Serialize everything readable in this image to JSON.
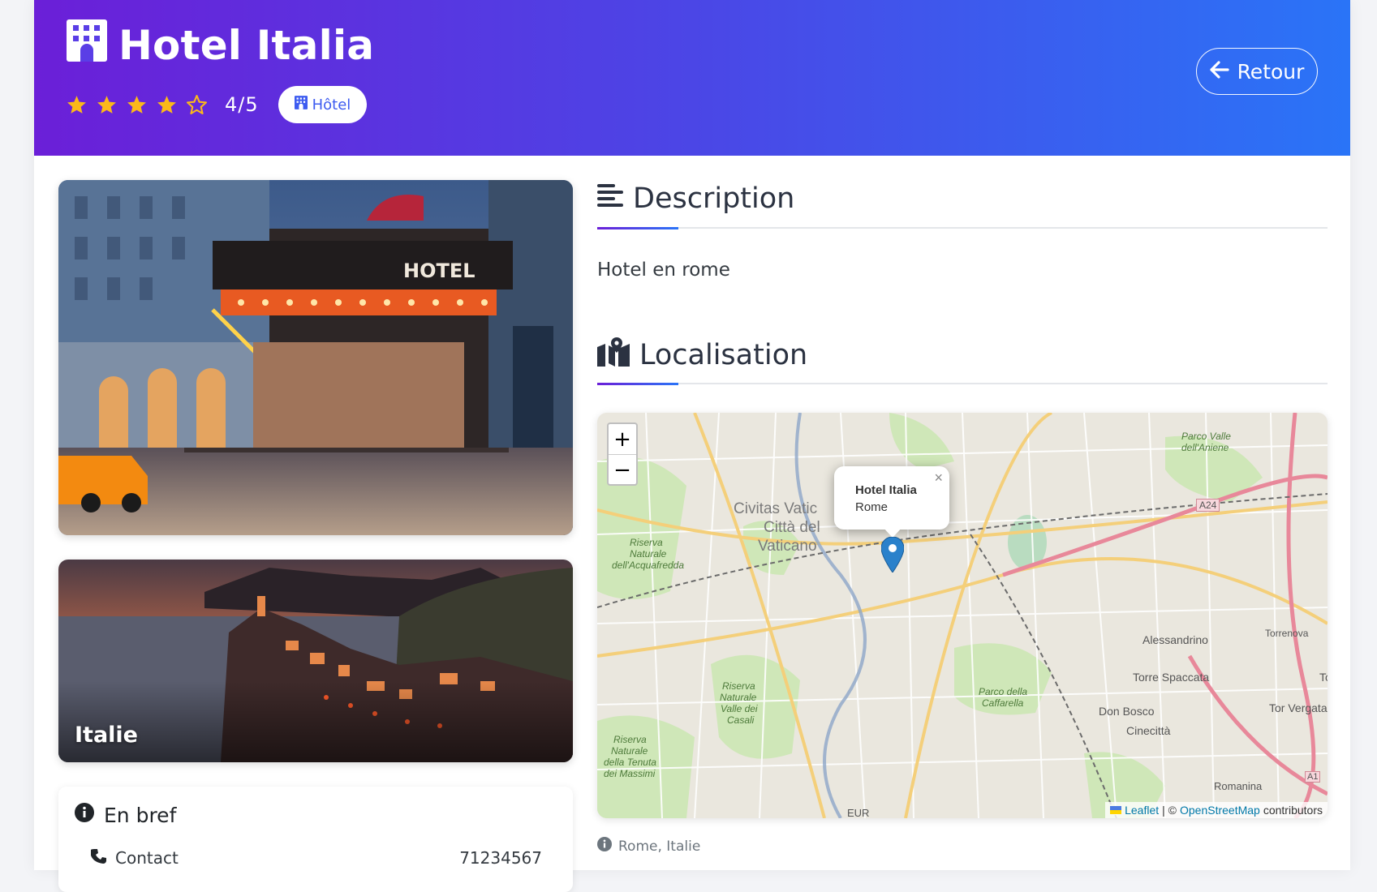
{
  "header": {
    "title": "Hotel Italia",
    "rating": 4,
    "rating_max": 5,
    "rating_text": "4/5",
    "type_badge": "Hôtel",
    "back_label": "Retour",
    "gradient_start": "#6b1fd8",
    "gradient_end": "#2a74f7"
  },
  "photo": {
    "sign_text": "HOTEL"
  },
  "destination": {
    "label": "Italie"
  },
  "brief": {
    "title": "En bref",
    "contact_label": "Contact",
    "contact_value": "71234567"
  },
  "description": {
    "heading": "Description",
    "text": "Hotel en rome"
  },
  "localisation": {
    "heading": "Localisation",
    "zoom_in": "+",
    "zoom_out": "−",
    "popup_title": "Hotel Italia",
    "popup_subtitle": "Rome",
    "popup_close": "×",
    "attribution_leaflet": "Leaflet",
    "attribution_sep": "| ©",
    "attribution_osm": "OpenStreetMap",
    "attribution_tail": "contributors",
    "address": "Rome, Italie",
    "labels": {
      "vatican_1": "Civitas Vatic",
      "vatican_2": "Città del",
      "vatican_3": "Vaticano",
      "riserva_1": "Riserva",
      "riserva_2": "Naturale",
      "riserva_3": "dell'Acquafredda",
      "parco_aniene_1": "Parco Valle",
      "parco_aniene_2": "dell'Aniene",
      "a24": "A24",
      "alessandrino": "Alessandrino",
      "torrenova": "Torrenova",
      "torre_spaccata": "Torre Spaccata",
      "parco_caffarella_1": "Parco della",
      "parco_caffarella_2": "Caffarella",
      "don_bosco": "Don Bosco",
      "cinecitta": "Cinecittà",
      "tor_vergata": "Tor Vergata",
      "romanina": "Romanina",
      "a1": "A1",
      "eur": "EUR",
      "valle_casali_1": "Riserva",
      "valle_casali_2": "Naturale",
      "valle_casali_3": "Valle dei",
      "valle_casali_4": "Casali",
      "massimi_1": "Riserva",
      "massimi_2": "Naturale",
      "massimi_3": "della Tenuta",
      "massimi_4": "dei Massimi",
      "to_1": "To"
    }
  },
  "colors": {
    "star": "#fbb91a",
    "accent_blue": "#3d5bf0",
    "marker": "#2a81cb"
  }
}
